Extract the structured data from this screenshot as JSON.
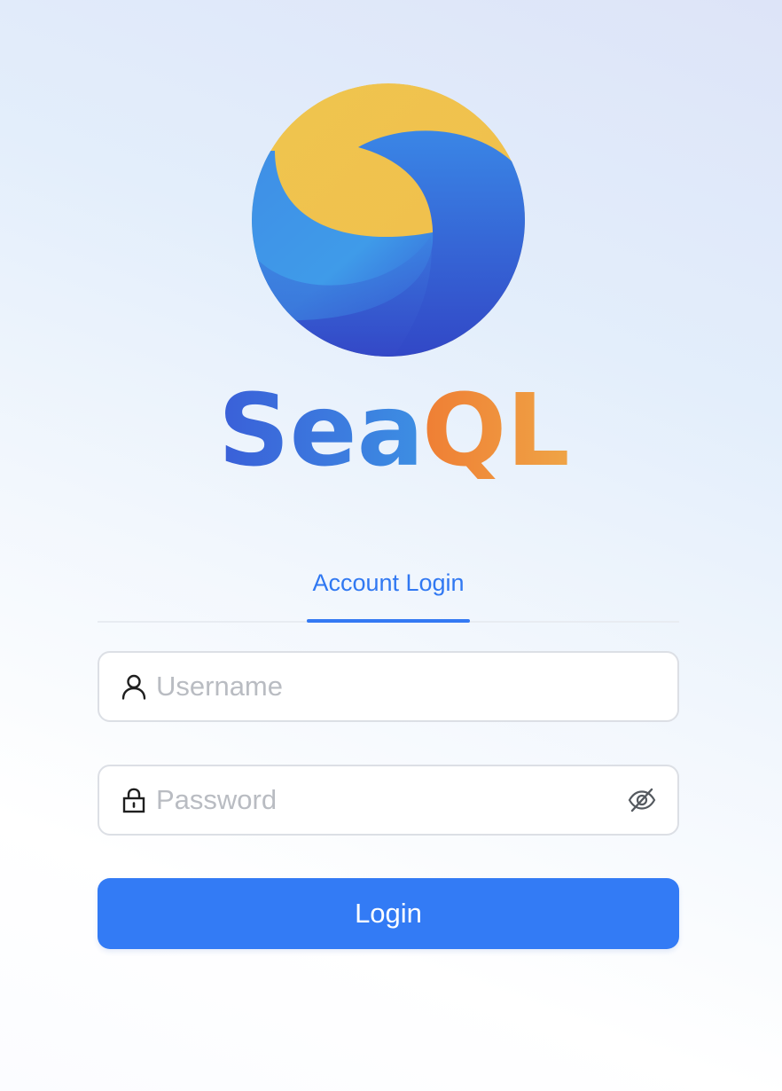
{
  "logo": {
    "word_sea": "Sea",
    "word_ql": "QL",
    "colors": {
      "blue": "#3a6fde",
      "blue_light": "#3f9be8",
      "orange": "#ef8a35",
      "yellow": "#efc54e"
    }
  },
  "tabs": [
    {
      "label": "Account Login",
      "active": true
    }
  ],
  "form": {
    "username": {
      "placeholder": "Username",
      "value": "",
      "icon": "user-icon"
    },
    "password": {
      "placeholder": "Password",
      "value": "",
      "icon": "lock-icon",
      "toggle_icon": "eye-off-icon"
    },
    "submit_label": "Login"
  },
  "theme": {
    "accent": "#337bf5",
    "tab_text": "#3078f2",
    "placeholder": "#b9bcc2",
    "border": "#dcdfe5"
  }
}
